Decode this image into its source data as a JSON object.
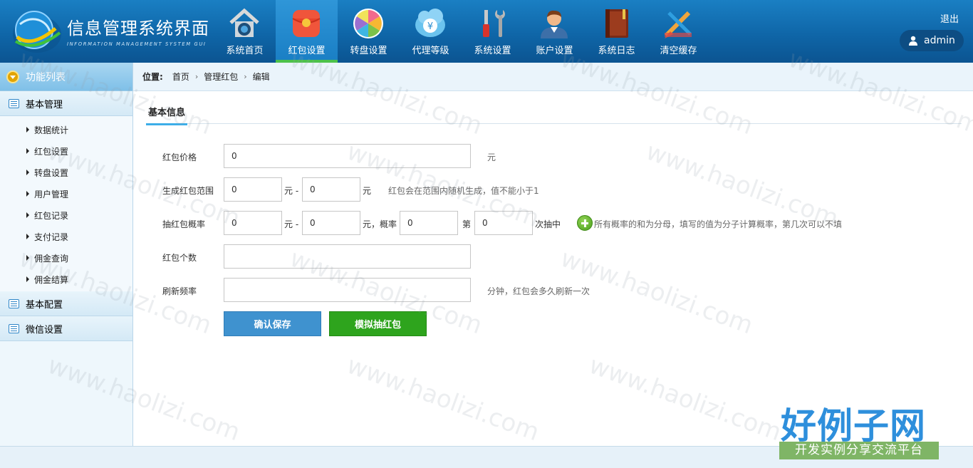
{
  "header": {
    "app_title": "信息管理系统界面",
    "app_subtitle": "INFORMATION MANAGEMENT SYSTEM GUI",
    "logout_label": "退出",
    "username": "admin",
    "nav": [
      {
        "label": "系统首页",
        "icon": "home-icon"
      },
      {
        "label": "红包设置",
        "icon": "red-envelope-icon",
        "active": true
      },
      {
        "label": "转盘设置",
        "icon": "wheel-icon"
      },
      {
        "label": "代理等级",
        "icon": "money-icon"
      },
      {
        "label": "系统设置",
        "icon": "tools-icon"
      },
      {
        "label": "账户设置",
        "icon": "user-icon"
      },
      {
        "label": "系统日志",
        "icon": "book-icon"
      },
      {
        "label": "清空缓存",
        "icon": "clear-icon"
      }
    ]
  },
  "sidebar": {
    "title": "功能列表",
    "groups": [
      {
        "label": "基本管理",
        "items": [
          "数据统计",
          "红包设置",
          "转盘设置",
          "用户管理",
          "红包记录",
          "支付记录",
          "佣金查询",
          "佣金结算"
        ]
      },
      {
        "label": "基本配置"
      },
      {
        "label": "微信设置"
      }
    ]
  },
  "breadcrumb": {
    "prefix": "位置:",
    "items": [
      "首页",
      "管理红包",
      "编辑"
    ]
  },
  "tab": {
    "label": "基本信息"
  },
  "form": {
    "price": {
      "label": "红包价格",
      "value": "0",
      "unit": "元"
    },
    "range": {
      "label": "生成红包范围",
      "min": "0",
      "sep": "元 -",
      "max": "0",
      "unit": "元",
      "hint": "红包会在范围内随机生成，值不能小于1"
    },
    "prob": {
      "label": "抽红包概率",
      "min": "0",
      "sep": "元 -",
      "max": "0",
      "rate_label": "元，概率",
      "rate": "0",
      "nth_label": "第",
      "nth": "0",
      "suffix": "次抽中",
      "hint": "所有概率的和为分母，填写的值为分子计算概率，第几次可以不填"
    },
    "count": {
      "label": "红包个数",
      "value": ""
    },
    "refresh": {
      "label": "刷新频率",
      "value": "",
      "hint": "分钟，红包会多久刷新一次"
    },
    "save_label": "确认保存",
    "simulate_label": "模拟抽红包"
  },
  "watermark": {
    "text": "www.haolizi.com",
    "brand": "好例子网",
    "brand_sub": "开发实例分享交流平台"
  },
  "colors": {
    "header": "#1373b8",
    "active_tab": "#2f96d8",
    "save_button": "#3f92cf",
    "simulate_button": "#2ea41d"
  }
}
